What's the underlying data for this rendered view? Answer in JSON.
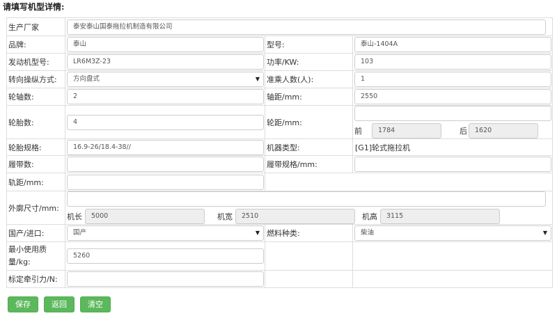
{
  "page": {
    "title": "请填写机型详情:"
  },
  "fields": {
    "manufacturer": {
      "label": "生产厂家",
      "value": "泰安泰山国泰拖拉机制造有限公司"
    },
    "brand": {
      "label": "品牌:",
      "value": "泰山"
    },
    "model": {
      "label": "型号:",
      "value": "泰山-1404A"
    },
    "engine_model": {
      "label": "发动机型号:",
      "value": "LR6M3Z-23"
    },
    "power": {
      "label": "功率/KW:",
      "value": "103"
    },
    "steering": {
      "label": "转向操纵方式:",
      "value": "方向盘式"
    },
    "passengers": {
      "label": "准乘人数(人):",
      "value": "1"
    },
    "axles": {
      "label": "轮轴数:",
      "value": "2"
    },
    "wheelbase": {
      "label": "轴距/mm:",
      "value": "2550"
    },
    "tires": {
      "label": "轮胎数:",
      "value": "4"
    },
    "track": {
      "label": "轮距/mm:",
      "value": "",
      "front_label": "前",
      "front_value": "1784",
      "rear_label": "后",
      "rear_value": "1620"
    },
    "tire_spec": {
      "label": "轮胎规格:",
      "value": "16.9-26/18.4-38//"
    },
    "machine_type": {
      "label": "机器类型:",
      "value": "[G1]轮式拖拉机"
    },
    "crawlers": {
      "label": "履带数:",
      "value": ""
    },
    "crawler_spec": {
      "label": "履带规格/mm:",
      "value": ""
    },
    "gauge": {
      "label": "轨距/mm:",
      "value": ""
    },
    "dimensions": {
      "label": "外廓尺寸/mm:",
      "value": "",
      "length_label": "机长",
      "length_value": "5000",
      "width_label": "机宽",
      "width_value": "2510",
      "height_label": "机高",
      "height_value": "3115"
    },
    "origin": {
      "label": "国产/进口:",
      "value": "国产"
    },
    "fuel": {
      "label": "燃料种类:",
      "value": "柴油"
    },
    "min_mass": {
      "label": "最小使用质量/kg:",
      "value": "5260"
    },
    "traction": {
      "label": "标定牵引力/N:",
      "value": ""
    }
  },
  "buttons": {
    "save": "保存",
    "back": "返回",
    "clear": "清空"
  }
}
